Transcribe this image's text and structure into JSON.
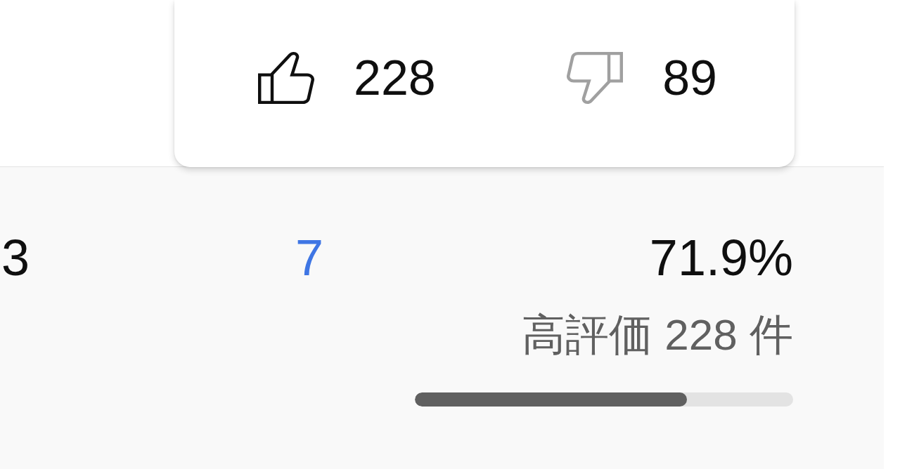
{
  "tooltip": {
    "items": [
      {
        "kind": "like",
        "count": "228"
      },
      {
        "kind": "dislike",
        "count": "89"
      }
    ]
  },
  "row": {
    "column_1": "3",
    "column_2": "7",
    "percent": "71.9%",
    "caption": "高評価 228 件",
    "level": 0.719
  }
}
